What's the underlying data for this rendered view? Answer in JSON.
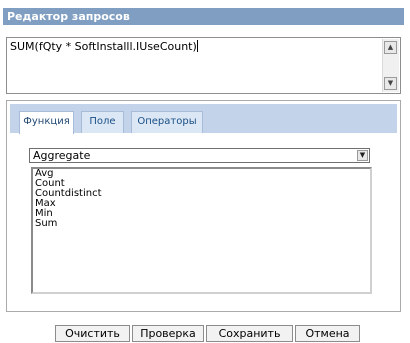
{
  "window": {
    "title": "Редактор запросов"
  },
  "editor": {
    "expression": "SUM(fQty * SoftInstalll.IUseCount)"
  },
  "tabs": [
    {
      "label": "Функция",
      "active": true
    },
    {
      "label": "Поле",
      "active": false
    },
    {
      "label": "Операторы",
      "active": false
    }
  ],
  "function_type": {
    "selected": "Aggregate"
  },
  "functions": [
    "Avg",
    "Count",
    "Countdistinct",
    "Max",
    "Min",
    "Sum"
  ],
  "buttons": {
    "clear": "Очистить",
    "check": "Проверка",
    "save": "Сохранить",
    "cancel": "Отмена"
  }
}
